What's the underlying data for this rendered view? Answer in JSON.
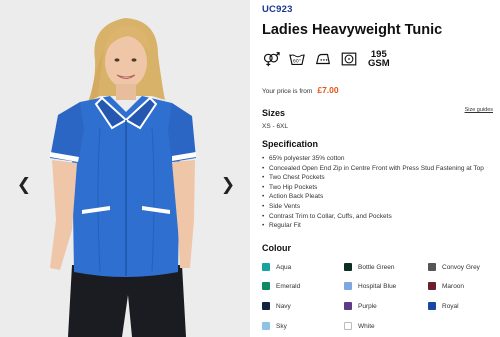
{
  "product": {
    "code": "UC923",
    "title": "Ladies Heavyweight Tunic",
    "gsm_number": "195",
    "gsm_unit": "GSM",
    "price_label": "Your price is from",
    "price_value": "£7.00"
  },
  "care_icons": [
    "gender-icon",
    "wash-60-icon",
    "iron-icon",
    "tumble-dry-icon"
  ],
  "wash_temp": "60°",
  "sizes": {
    "title": "Sizes",
    "size_guide_label": "Size guides",
    "range": "XS - 6XL"
  },
  "specification": {
    "title": "Specification",
    "items": [
      "65% polyester 35% cotton",
      "Concealed Open End Zip in Centre Front with Press Stud Fastening at Top",
      "Two Chest Pockets",
      "Two Hip Pockets",
      "Action Back Pleats",
      "Side Vents",
      "Contrast Trim to Collar, Cuffs, and Pockets",
      "Regular Fit"
    ]
  },
  "colour": {
    "title": "Colour",
    "swatches": [
      {
        "name": "Aqua",
        "color": "#18a3a0"
      },
      {
        "name": "Bottle Green",
        "color": "#0c2d22"
      },
      {
        "name": "Convoy Grey",
        "color": "#555659"
      },
      {
        "name": "Emerald",
        "color": "#0d8a64"
      },
      {
        "name": "Hospital Blue",
        "color": "#7ea9e0"
      },
      {
        "name": "Maroon",
        "color": "#6e1d2c"
      },
      {
        "name": "Navy",
        "color": "#13233f"
      },
      {
        "name": "Purple",
        "color": "#5b3c86"
      },
      {
        "name": "Royal",
        "color": "#1a46a8"
      },
      {
        "name": "Sky",
        "color": "#8ec3e8"
      },
      {
        "name": "White",
        "color": "#ffffff"
      }
    ]
  },
  "gallery": {
    "prev_glyph": "❮",
    "next_glyph": "❯"
  },
  "colors": {
    "brand_blue": "#1a3a8f",
    "price_orange": "#e2541c",
    "tunic_blue": "#2f6fd0"
  }
}
